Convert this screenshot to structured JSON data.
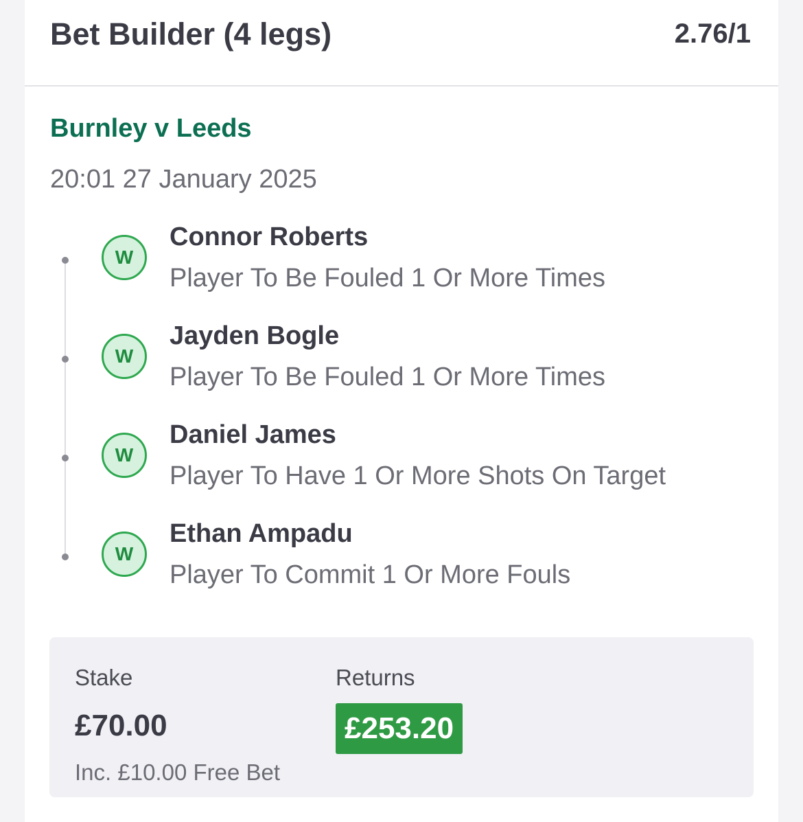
{
  "bet": {
    "title": "Bet Builder (4 legs)",
    "odds": "2.76/1"
  },
  "event": {
    "name": "Burnley v Leeds",
    "datetime": "20:01 27 January 2025"
  },
  "legs": [
    {
      "result": "W",
      "player": "Connor Roberts",
      "market": "Player To Be Fouled 1 Or More Times"
    },
    {
      "result": "W",
      "player": "Jayden Bogle",
      "market": "Player To Be Fouled 1 Or More Times"
    },
    {
      "result": "W",
      "player": "Daniel James",
      "market": "Player To Have 1 Or More Shots On Target"
    },
    {
      "result": "W",
      "player": "Ethan Ampadu",
      "market": "Player To Commit 1 Or More Fouls"
    }
  ],
  "summary": {
    "stake_label": "Stake",
    "stake_value": "£70.00",
    "stake_note": "Inc. £10.00 Free Bet",
    "returns_label": "Returns",
    "returns_value": "£253.20"
  },
  "colors": {
    "event_green": "#0c6f52",
    "win_badge_border": "#2ea84f",
    "win_badge_fill": "#d6f2de",
    "returns_badge": "#2f9a44",
    "text_dark": "#3a3b45",
    "text_muted": "#6b6c74"
  }
}
